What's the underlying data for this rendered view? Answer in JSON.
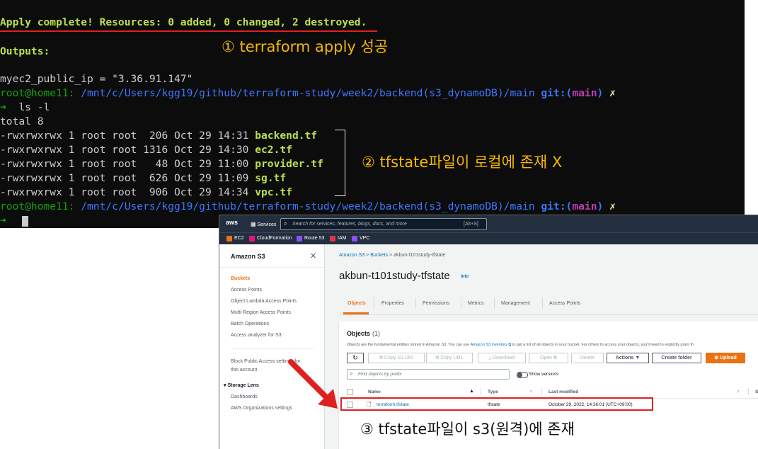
{
  "terminal": {
    "apply_msg": "Apply complete! Resources: 0 added, 0 changed, 2 destroyed.",
    "outputs_label": "Outputs:",
    "output_line": "myec2_public_ip = \"3.36.91.147\"",
    "prompt_user": "root@home11:",
    "prompt_path": " /mnt/c/Users/kgg19/github/terraform-study/week2/backend(s3_dynamoDB)/main",
    "git_label": " git:(",
    "git_branch": "main",
    "git_close": ")",
    "dirty_mark": " ✗",
    "arrow": "➜",
    "command": "  ls -l",
    "total": "total 8",
    "files": [
      {
        "meta": "-rwxrwxrwx 1 root root  206 Oct 29 14:31 ",
        "name": "backend.tf"
      },
      {
        "meta": "-rwxrwxrwx 1 root root 1316 Oct 29 14:30 ",
        "name": "ec2.tf"
      },
      {
        "meta": "-rwxrwxrwx 1 root root   48 Oct 29 11:00 ",
        "name": "provider.tf"
      },
      {
        "meta": "-rwxrwxrwx 1 root root  626 Oct 29 11:09 ",
        "name": "sg.tf"
      },
      {
        "meta": "-rwxrwxrwx 1 root root  906 Oct 29 14:34 ",
        "name": "vpc.tf"
      }
    ]
  },
  "annotations": {
    "one": "① terraform apply 성공",
    "two": "② tfstate파일이 로컬에 존재 X",
    "three": "③ tfstate파일이 s3(원격)에 존재"
  },
  "colors": {
    "annotation": "#f5b800",
    "highlight": "#e02020",
    "aws_orange": "#ec7211",
    "aws_link": "#0073bb"
  },
  "aws": {
    "logo": "aws",
    "services": "Services",
    "search_placeholder": "Search for services, features, blogs, docs, and more",
    "search_shortcut": "[Alt+S]",
    "favorites": [
      "EC2",
      "CloudFormation",
      "Route 53",
      "IAM",
      "VPC"
    ],
    "sidebar": {
      "title": "Amazon S3",
      "items": [
        "Buckets",
        "Access Points",
        "Object Lambda Access Points",
        "Multi-Region Access Points",
        "Batch Operations",
        "Access analyzer for S3"
      ],
      "block_public_1": "Block Public Access settings for",
      "block_public_2": "this account",
      "storage_lens": "Storage Lens",
      "lens_items": [
        "Dashboards",
        "AWS Organizations settings"
      ]
    },
    "breadcrumb": [
      "Amazon S3",
      "Buckets",
      "akbun-t101study-tfstate"
    ],
    "bucket_title": "akbun-t101study-tfstate",
    "info": "Info",
    "tabs": [
      "Objects",
      "Properties",
      "Permissions",
      "Metrics",
      "Management",
      "Access Points"
    ],
    "objects_title": "Objects",
    "objects_count": "(1)",
    "objects_desc": "Objects are the fundamental entities stored in Amazon S3. You can use",
    "objects_desc_link": "Amazon S3 inventory",
    "objects_desc_tail": "to get a list of all objects in your bucket. For others to access your objects, you'll need to explicitly grant th",
    "buttons": {
      "copy_uri": "Copy S3 URI",
      "copy_url": "Copy URL",
      "download": "Download",
      "open": "Open",
      "delete": "Delete",
      "actions": "Actions ▼",
      "create_folder": "Create folder",
      "upload": "Upload"
    },
    "find_placeholder": "Find objects by prefix",
    "show_versions": "Show versions",
    "columns": {
      "name": "Name",
      "type": "Type",
      "last_modified": "Last modified",
      "s": "S"
    },
    "rows": [
      {
        "name": "terraform.tfstate",
        "type": "tfstate",
        "last_modified": "October 29, 2022, 14:36:01 (UTC+09:00)"
      }
    ]
  }
}
